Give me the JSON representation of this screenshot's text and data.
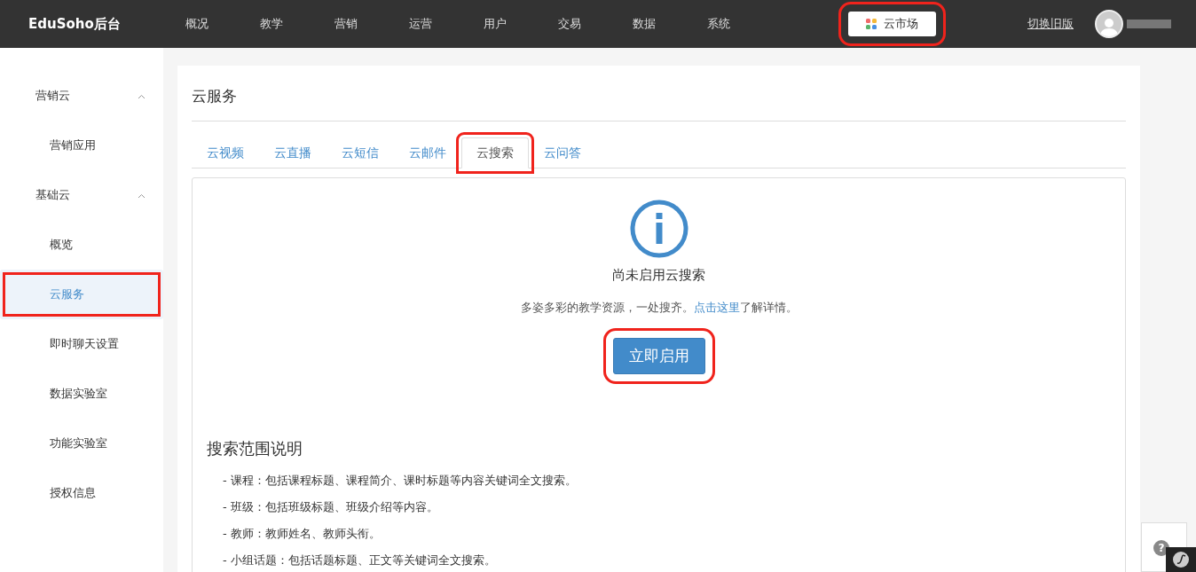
{
  "header": {
    "brand": "EduSoho后台",
    "nav": [
      {
        "label": "概况"
      },
      {
        "label": "教学"
      },
      {
        "label": "营销"
      },
      {
        "label": "运营"
      },
      {
        "label": "用户"
      },
      {
        "label": "交易"
      },
      {
        "label": "数据"
      },
      {
        "label": "系统"
      }
    ],
    "market": {
      "label": "云市场",
      "highlighted": true
    },
    "switch_label": "切换旧版"
  },
  "sidebar": {
    "groups": [
      {
        "label": "营销云",
        "expanded": true,
        "children": [
          {
            "label": "营销应用",
            "selected": false,
            "highlighted": false
          }
        ]
      },
      {
        "label": "基础云",
        "expanded": true,
        "children": [
          {
            "label": "概览",
            "selected": false,
            "highlighted": false
          },
          {
            "label": "云服务",
            "selected": true,
            "highlighted": true
          },
          {
            "label": "即时聊天设置",
            "selected": false,
            "highlighted": false
          },
          {
            "label": "数据实验室",
            "selected": false,
            "highlighted": false
          },
          {
            "label": "功能实验室",
            "selected": false,
            "highlighted": false
          },
          {
            "label": "授权信息",
            "selected": false,
            "highlighted": false
          }
        ]
      }
    ]
  },
  "panel": {
    "title": "云服务",
    "tabs": [
      {
        "label": "云视频",
        "selected": false,
        "highlighted": false
      },
      {
        "label": "云直播",
        "selected": false,
        "highlighted": false
      },
      {
        "label": "云短信",
        "selected": false,
        "highlighted": false
      },
      {
        "label": "云邮件",
        "selected": false,
        "highlighted": false
      },
      {
        "label": "云搜索",
        "selected": true,
        "highlighted": true
      },
      {
        "label": "云问答",
        "selected": false,
        "highlighted": false
      }
    ],
    "notice": {
      "title": "尚未启用云搜索",
      "description": "多姿多彩的教学资源，一处搜齐。",
      "link": "点击这里",
      "description_end": "了解详情。",
      "button": {
        "label": "立即启用",
        "highlighted": true
      }
    },
    "scope": {
      "title": "搜索范围说明",
      "items": [
        "- 课程：包括课程标题、课程简介、课时标题等内容关键词全文搜索。",
        "- 班级：包括班级标题、班级介绍等内容。",
        "- 教师：教师姓名、教师头衔。",
        "- 小组话题：包括话题标题、正文等关键词全文搜索。"
      ]
    }
  },
  "help_button": "?"
}
